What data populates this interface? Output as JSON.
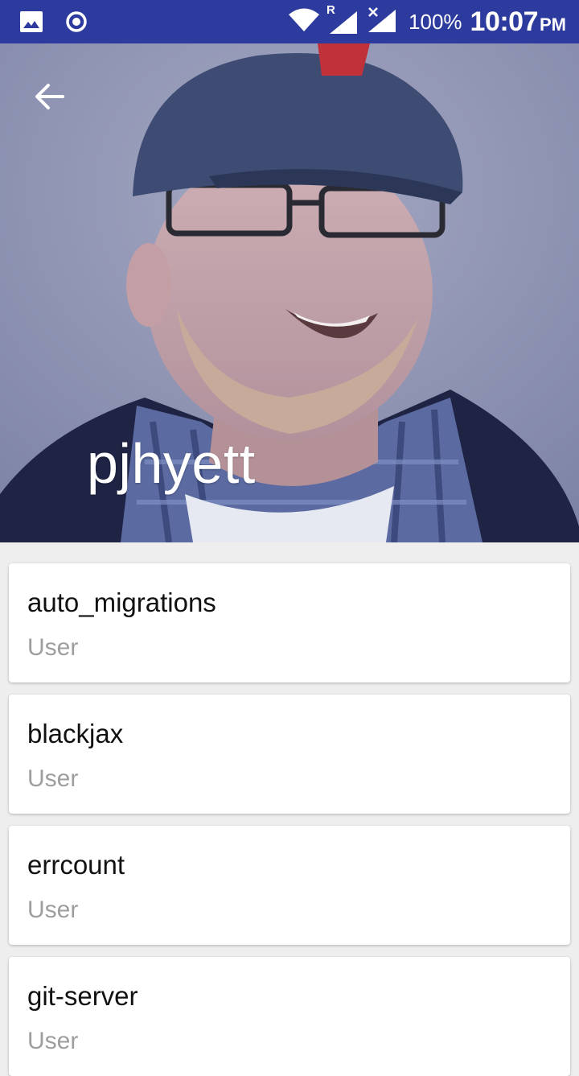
{
  "status_bar": {
    "icons": [
      "image-icon",
      "record-icon",
      "wifi-icon",
      "signal-roaming-icon",
      "signal-no-data-icon"
    ],
    "roaming_indicator": "R",
    "battery": "100%",
    "time": "10:07",
    "ampm": "PM",
    "color": "#2e3b9e"
  },
  "header": {
    "back_icon": "arrow-back-icon",
    "title": "pjhyett"
  },
  "items": [
    {
      "title": "auto_migrations",
      "subtitle": "User"
    },
    {
      "title": "blackjax",
      "subtitle": "User"
    },
    {
      "title": "errcount",
      "subtitle": "User"
    },
    {
      "title": "git-server",
      "subtitle": "User"
    }
  ]
}
